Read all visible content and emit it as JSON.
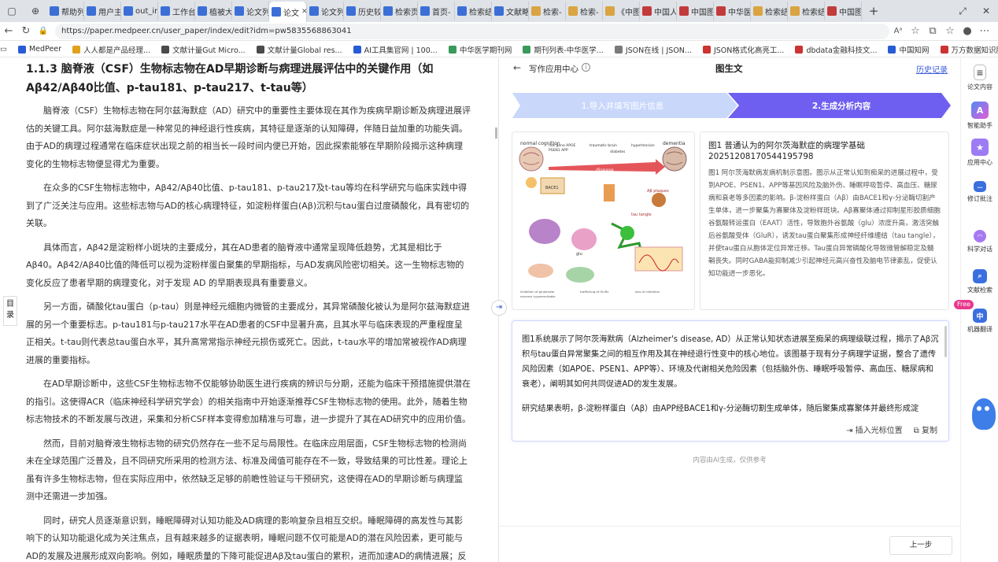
{
  "tabs": [
    {
      "label": "帮助列",
      "color": "#3b6fd6"
    },
    {
      "label": "用户主",
      "color": "#3b6fd6"
    },
    {
      "label": "out_im",
      "color": "#3b6fd6"
    },
    {
      "label": "工作台",
      "color": "#3b6fd6"
    },
    {
      "label": "植被大",
      "color": "#3b6fd6"
    },
    {
      "label": "论文列",
      "color": "#3b6fd6"
    },
    {
      "label": "论文",
      "color": "#3b6fd6",
      "active": true
    },
    {
      "label": "论文列",
      "color": "#3b6fd6"
    },
    {
      "label": "历史较",
      "color": "#3b6fd6"
    },
    {
      "label": "检索页",
      "color": "#3b6fd6"
    },
    {
      "label": "首页-",
      "color": "#3b6fd6"
    },
    {
      "label": "检索结",
      "color": "#3b6fd6"
    },
    {
      "label": "文献略",
      "color": "#3b6fd6"
    },
    {
      "label": "检索-",
      "color": "#d9a441"
    },
    {
      "label": "检索-",
      "color": "#d9a441"
    },
    {
      "label": "《中图",
      "color": "#d9a441"
    },
    {
      "label": "中国人",
      "color": "#c23b3b"
    },
    {
      "label": "中国图",
      "color": "#c23b3b"
    },
    {
      "label": "中华医",
      "color": "#c23b3b"
    },
    {
      "label": "检索结",
      "color": "#d9a441"
    },
    {
      "label": "检索结",
      "color": "#d9a441"
    },
    {
      "label": "中国图",
      "color": "#c23b3b"
    }
  ],
  "url": "https://paper.medpeer.cn/user_paper/index/edit?idm=pw5835568863041",
  "bookmarks": [
    {
      "label": "MedPeer",
      "color": "#2a5bd7"
    },
    {
      "label": "人人都是产品经理...",
      "color": "#e0a019"
    },
    {
      "label": "文献计量Gut Micro...",
      "color": "#4a4a4a"
    },
    {
      "label": "文献计量Global res...",
      "color": "#4a4a4a"
    },
    {
      "label": "AI工具集官网 | 100...",
      "color": "#2a5bd7"
    },
    {
      "label": "中华医学期刊网",
      "color": "#3a9a5a"
    },
    {
      "label": "期刊列表-中华医学...",
      "color": "#3a9a5a"
    },
    {
      "label": "JSON在线 | JSON...",
      "color": "#7a7a7a"
    },
    {
      "label": "JSON格式化高亮工...",
      "color": "#c33"
    },
    {
      "label": "dbdata金融科技文...",
      "color": "#c33"
    },
    {
      "label": "中国知网",
      "color": "#2a5bd7"
    },
    {
      "label": "万方数据知识服务...",
      "color": "#c33"
    }
  ],
  "article": {
    "heading": "1.1.3 脑脊液（CSF）生物标志物在AD早期诊断与病理进展评估中的关键作用（如Aβ42/Aβ40比值、p-tau181、p-tau217、t-tau等）",
    "paragraphs": [
      "脑脊液（CSF）生物标志物在阿尔兹海默症（AD）研究中的重要性主要体现在其作为疾病早期诊断及病理进展评估的关键工具。阿尔兹海默症是一种常见的神经退行性疾病，其特征是逐渐的认知障碍，伴随日益加重的功能失调。由于AD的病理过程通常在临床症状出现之前的相当长一段时间内便已开始，因此探索能够在早期阶段揭示这种病理变化的生物标志物便显得尤为重要。",
      "在众多的CSF生物标志物中，Aβ42/Aβ40比值、p-tau181、p-tau217及t-tau等均在科学研究与临床实践中得到了广泛关注与应用。这些标志物与AD的核心病理特征，如淀粉样蛋白(Aβ)沉积与tau蛋白过度磷酸化，具有密切的关联。",
      "具体而言，Aβ42是淀粉样小斑块的主要成分，其在AD患者的脑脊液中通常呈现降低趋势，尤其是相比于Aβ40。Aβ42/Aβ40比值的降低可以视为淀粉样蛋白聚集的早期指标，与AD发病风险密切相关。这一生物标志物的变化反应了患者早期的病理变化，对于发现 AD 的早期表现具有重要意义。",
      "另一方面，磷酸化tau蛋白（p-tau）则是神经元细胞内微管的主要成分，其异常磷酸化被认为是阿尔兹海默症进展的另一个重要标志。p-tau181与p-tau217水平在AD患者的CSF中显著升高，且其水平与临床表现的严重程度呈正相关。t-tau则代表总tau蛋白水平，其升高常常指示神经元损伤或死亡。因此，t-tau水平的增加常被视作AD病理进展的重要指标。",
      "在AD早期诊断中，这些CSF生物标志物不仅能够协助医生进行疾病的辨识与分期，还能为临床干预措施提供潜在的指引。这使得ACR（临床神经科学研究学会）的相关指南中开始逐渐推荐CSF生物标志物的使用。此外，随着生物标志物技术的不断发展与改进，采集和分析CSF样本变得愈加精准与可靠，进一步提升了其在AD研究中的应用价值。",
      "然而，目前对脑脊液生物标志物的研究仍然存在一些不足与局限性。在临床应用层面，CSF生物标志物的检测尚未在全球范围广泛普及，且不同研究所采用的检测方法、标准及阈值可能存在不一致，导致结果的可比性差。理论上虽有许多生物标志物，但在实际应用中，依然缺乏足够的前瞻性验证与干预研究，这使得在AD的早期诊断与病理监测中还需进一步加强。",
      "同时，研究人员逐渐意识到，睡眠障碍对认知功能及AD病理的影响复杂且相互交织。睡眠障碍的高发性与其影响下的认知功能退化成为关注焦点，且有越来越多的证据表明，睡眠问题不仅可能是AD的潜在风险因素，更可能与AD的发展及进展形成双向影响。例如，睡眠质量的下降可能促进Aβ及tau蛋白的累积，进而加速AD的病情进展；反之，AD的病理改变又可能导致睡眠障碍的出现与加重。"
    ],
    "toc_label": "目录"
  },
  "panel": {
    "back_label": "写作应用中心",
    "title": "图生文",
    "history_link": "历史记录",
    "step1": "1.导入并填写图片信息",
    "step2": "2.生成分析内容",
    "figure_title": "图1 普通认为的阿尔茨海默症的病理学基础",
    "figure_id": "20251208170544195798",
    "figure_desc": "图1 阿尔茨海默病发病机制示意图。图示从正常认知到痴呆的进展过程中，受到APOE、PSEN1、APP等基因风险及脑外伤、睡眠呼吸暂停、高血压、糖尿病和衰老等多因素的影响。β-淀粉样蛋白（Aβ）由BACE1和γ-分泌酶切割产生单体，进一步聚集为寡聚体及淀粉样斑块。Aβ寡聚体通过抑制星形胶质细胞谷氨酸转运蛋白（EAAT）活性，导致胞外谷氨酸（glu）浓度升高，激活突触后谷氨酸受体（GluR），诱发tau蛋白聚集形成神经纤维缠结（tau tangle），并使tau蛋白从胞体定位异常迁移。Tau蛋白异常磷酸化导致微管解稳定及髓鞘丧失。同时GABA能抑制减少引起神经元高兴奋性及脑电节律紊乱，促使认知功能进一步恶化。",
    "result_p1": "图1系统展示了阿尔茨海默病（Alzheimer's disease, AD）从正常认知状态进展至痴呆的病理级联过程，揭示了Aβ沉积与tau蛋白异常聚集之间的相互作用及其在神经退行性变中的核心地位。该图基于现有分子病理学证据，整合了遗传风险因素（如APOE、PSEN1、APP等）、环境及代谢相关危险因素（包括脑外伤、睡眠呼吸暂停、高血压、糖尿病和衰老），阐明其如何共同促进AD的发生发展。",
    "result_p2": "研究结果表明，β-淀粉样蛋白（Aβ）由APP经BACE1和γ-分泌酶切割生成单体，随后聚集成寡聚体并最终形成淀",
    "insert_btn": "插入光标位置",
    "copy_btn": "复制",
    "disclaimer": "内容由AI生成，仅供参考",
    "prev_btn": "上一步"
  },
  "figure_labels": {
    "normal": "normal cognition",
    "dementia": "dementia",
    "disease": "disease",
    "plaques": "Aβ plaques",
    "glu": "glu",
    "bace": "BACE1",
    "tau": "tau tangle"
  },
  "right_tools": [
    {
      "label": "论文内容",
      "icon": "doc-icon",
      "color": "#f2f2f2"
    },
    {
      "label": "智能助手",
      "icon": "ai-assistant-icon",
      "color": "#7a5cf0"
    },
    {
      "label": "应用中心",
      "icon": "apps-icon",
      "color": "#8d6cf5"
    },
    {
      "label": "修订批注",
      "icon": "comment-icon",
      "color": "#3b6fe0"
    },
    {
      "label": "科学对话",
      "icon": "chat-icon",
      "color": "#9b6cf5"
    },
    {
      "label": "文献检索",
      "icon": "search-doc-icon",
      "color": "#3b6fe0"
    },
    {
      "label": "机器翻译",
      "icon": "translate-icon",
      "color": "#3b6fe0"
    }
  ],
  "free_badge": "Free"
}
